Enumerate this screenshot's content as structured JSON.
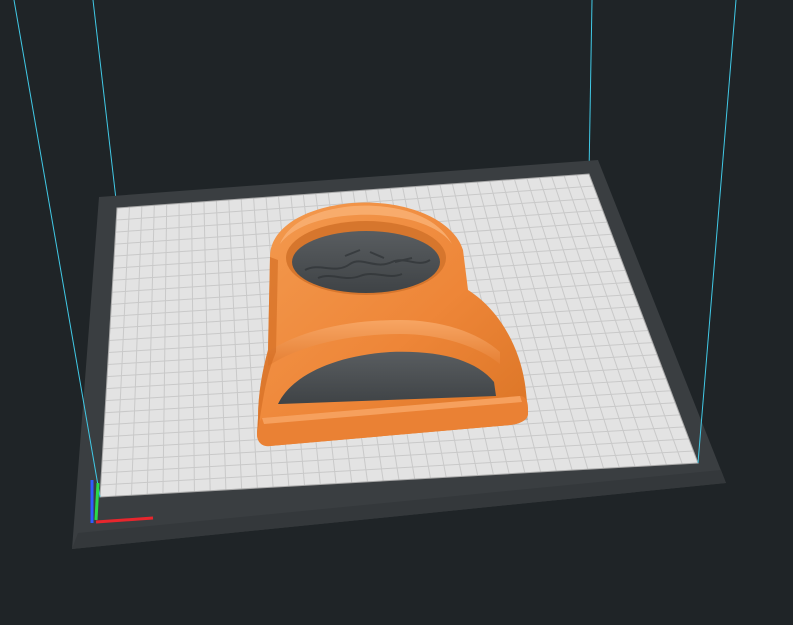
{
  "app": {
    "view": "3d-build-plate-viewport"
  },
  "colors": {
    "background": "#1f2427",
    "plate_border": "#3a3e41",
    "plate_surface": "#e3e3e3",
    "grid_line": "#c6c6c6",
    "build_volume_line": "#41c9e6",
    "model_orange": "#f08a3c",
    "model_shadow": "#c7682a",
    "model_cavity": "#4f5457",
    "axis_x": "#e8262d",
    "axis_y": "#2bd94a",
    "axis_z": "#2f5bff"
  },
  "scene": {
    "object": "orange-printed-part",
    "axes": [
      "x",
      "y",
      "z"
    ]
  }
}
